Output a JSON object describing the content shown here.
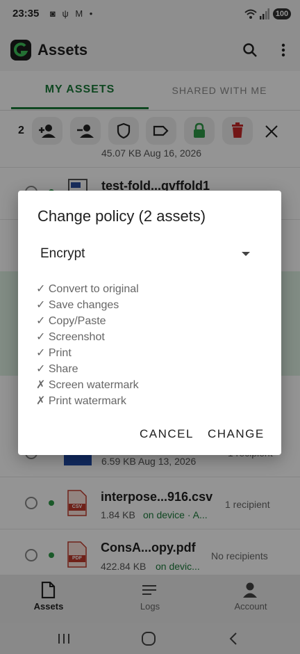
{
  "status_bar": {
    "time": "23:35",
    "icons_text": "◙ ψ M •",
    "battery": "100"
  },
  "app": {
    "title": "Assets"
  },
  "tabs": [
    {
      "label": "MY ASSETS"
    },
    {
      "label": "SHARED WITH ME"
    }
  ],
  "action_bar": {
    "selected_count": "2"
  },
  "files": [
    {
      "meta": "45.07 KB  Aug 16, 2026"
    },
    {
      "name": "test-fold...gvffold1"
    },
    {
      "meta": "6.59 KB  Aug 13, 2026",
      "recipients": "1 recipient"
    },
    {
      "name": "interpose...916.csv",
      "size": "1.84 KB",
      "location": "on device · A...",
      "recipients": "1 recipient",
      "icon_label": "CSV"
    },
    {
      "name": "ConsA...opy.pdf",
      "size": "422.84 KB",
      "location": "on devic...",
      "recipients": "No recipients",
      "icon_label": "PDF"
    }
  ],
  "dialog": {
    "title": "Change policy (2 assets)",
    "policy_value": "Encrypt",
    "permissions": [
      {
        "mark": "✓",
        "label": "Convert to original"
      },
      {
        "mark": "✓",
        "label": "Save changes"
      },
      {
        "mark": "✓",
        "label": "Copy/Paste"
      },
      {
        "mark": "✓",
        "label": "Screenshot"
      },
      {
        "mark": "✓",
        "label": "Print"
      },
      {
        "mark": "✓",
        "label": "Share"
      },
      {
        "mark": "✗",
        "label": "Screen watermark"
      },
      {
        "mark": "✗",
        "label": "Print watermark"
      }
    ],
    "cancel_label": "CANCEL",
    "change_label": "CHANGE"
  },
  "bottom_nav": [
    {
      "label": "Assets"
    },
    {
      "label": "Logs"
    },
    {
      "label": "Account"
    }
  ],
  "colors": {
    "accent": "#1b7a3a",
    "lock": "#2e9a48",
    "delete": "#c62828"
  }
}
